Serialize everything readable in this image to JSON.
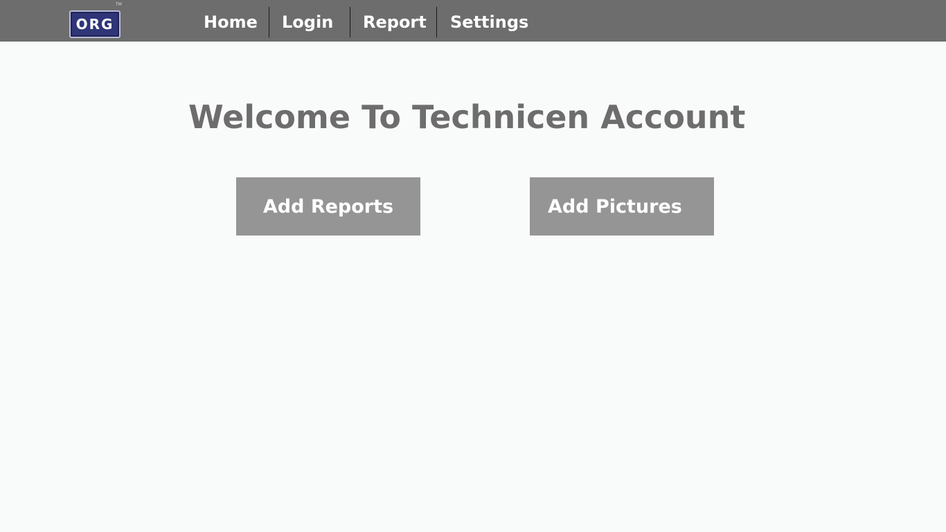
{
  "header": {
    "logo": {
      "text": "ORG",
      "tm": "TM",
      "colors": {
        "fill": "#2f3577",
        "border": "#b8bcd8"
      }
    },
    "nav": [
      {
        "label": "Home"
      },
      {
        "label": "Login"
      },
      {
        "label": "Report"
      },
      {
        "label": "Settings"
      }
    ],
    "background_color": "#6d6d6d"
  },
  "main": {
    "heading": "Welcome To Technicen Account",
    "buttons": [
      {
        "label": "Add Reports"
      },
      {
        "label": "Add Pictures"
      }
    ],
    "colors": {
      "heading": "#6d6d6d",
      "button_bg": "#959595",
      "page_bg": "#f9fafa"
    }
  }
}
